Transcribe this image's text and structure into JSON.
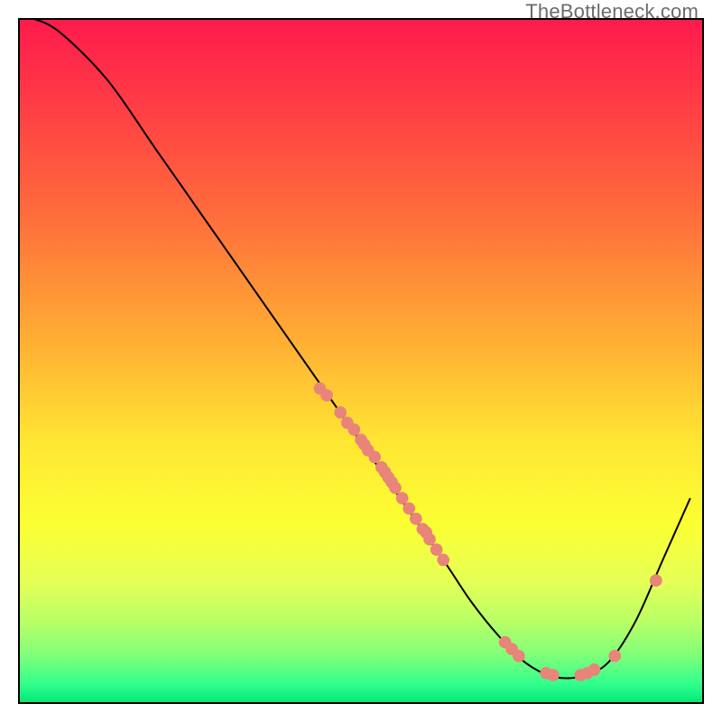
{
  "watermark": "TheBottleneck.com",
  "chart_data": {
    "type": "line",
    "title": "",
    "xlabel": "",
    "ylabel": "",
    "xlim": [
      0,
      100
    ],
    "ylim": [
      0,
      100
    ],
    "grid": false,
    "series": [
      {
        "name": "curve",
        "x": [
          2,
          6,
          13,
          20,
          27,
          34,
          41,
          48,
          55,
          62,
          66,
          70,
          74,
          78,
          82,
          86,
          90,
          94,
          98
        ],
        "y": [
          100,
          98,
          91,
          81,
          71,
          61,
          51,
          41,
          31,
          21,
          15,
          10,
          6,
          4,
          4,
          6,
          12,
          21,
          30
        ],
        "style": "smooth-black-line"
      },
      {
        "name": "dots-on-slope",
        "style": "salmon-dots",
        "points": [
          {
            "x": 44,
            "y": 46
          },
          {
            "x": 45,
            "y": 45
          },
          {
            "x": 47,
            "y": 42.5
          },
          {
            "x": 48,
            "y": 41
          },
          {
            "x": 49,
            "y": 40
          },
          {
            "x": 50,
            "y": 38.5
          },
          {
            "x": 50.5,
            "y": 37.8
          },
          {
            "x": 51,
            "y": 37
          },
          {
            "x": 52,
            "y": 36
          },
          {
            "x": 53,
            "y": 34.5
          },
          {
            "x": 53.5,
            "y": 33.8
          },
          {
            "x": 54,
            "y": 33
          },
          {
            "x": 54.5,
            "y": 32.3
          },
          {
            "x": 55,
            "y": 31.5
          },
          {
            "x": 56,
            "y": 30
          },
          {
            "x": 57,
            "y": 28.5
          },
          {
            "x": 58,
            "y": 27
          },
          {
            "x": 59,
            "y": 25.5
          },
          {
            "x": 59.5,
            "y": 25
          },
          {
            "x": 60,
            "y": 24
          },
          {
            "x": 61,
            "y": 22.5
          },
          {
            "x": 62,
            "y": 21
          }
        ]
      },
      {
        "name": "dots-in-valley",
        "style": "salmon-dots",
        "points": [
          {
            "x": 71,
            "y": 9
          },
          {
            "x": 72,
            "y": 8
          },
          {
            "x": 73,
            "y": 7
          },
          {
            "x": 77,
            "y": 4.5
          },
          {
            "x": 78,
            "y": 4.2
          },
          {
            "x": 82,
            "y": 4.2
          },
          {
            "x": 83,
            "y": 4.5
          },
          {
            "x": 84,
            "y": 5
          },
          {
            "x": 87,
            "y": 7
          },
          {
            "x": 93,
            "y": 18
          }
        ]
      }
    ],
    "background_gradient": {
      "direction": "vertical-top-to-bottom",
      "stops": [
        {
          "pos": 0.0,
          "color": "#ff1a4d"
        },
        {
          "pos": 0.28,
          "color": "#ff6a3c"
        },
        {
          "pos": 0.48,
          "color": "#ffb233"
        },
        {
          "pos": 0.74,
          "color": "#fbff33"
        },
        {
          "pos": 0.93,
          "color": "#7eff7a"
        },
        {
          "pos": 1.0,
          "color": "#00e676"
        }
      ]
    },
    "colors": {
      "curve": "#000000",
      "dots": "#e9847a"
    }
  }
}
